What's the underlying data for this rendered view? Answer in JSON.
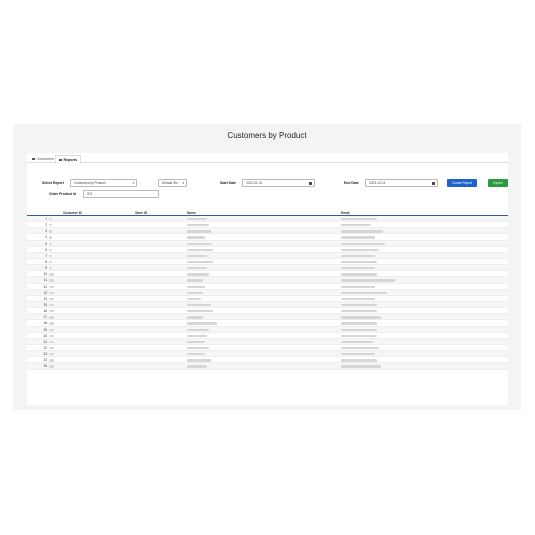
{
  "page": {
    "title": "Customers by Product"
  },
  "tabs": [
    {
      "label": "Customers",
      "icon": "users-icon"
    },
    {
      "label": "Reports",
      "icon": "report-icon"
    }
  ],
  "form": {
    "select_report_label": "Select Report",
    "select_report_value": "Customers by Product",
    "store_value": "Default Sto",
    "start_date_label": "Start Date",
    "start_date_value": "2022-01-01",
    "end_date_label": "End Date",
    "end_date_value": "2023-10-14",
    "order_product_label": "Order Product Id",
    "order_product_value": "374",
    "create_report_label": "Create Report",
    "export_label": "Export"
  },
  "table": {
    "headers": [
      "Customer ID",
      "Store ID",
      "Name",
      "Email"
    ],
    "row_numbers": [
      "1",
      "2",
      "3",
      "4",
      "5",
      "6",
      "7",
      "8",
      "9",
      "10",
      "11",
      "12",
      "13",
      "14",
      "15",
      "16",
      "17",
      "18",
      "19",
      "20",
      "21",
      "22",
      "23",
      "24",
      "25"
    ]
  },
  "colors": {
    "primary": "#1e63c8",
    "success": "#2a9a3e",
    "header_rule": "#2c5aa0"
  }
}
